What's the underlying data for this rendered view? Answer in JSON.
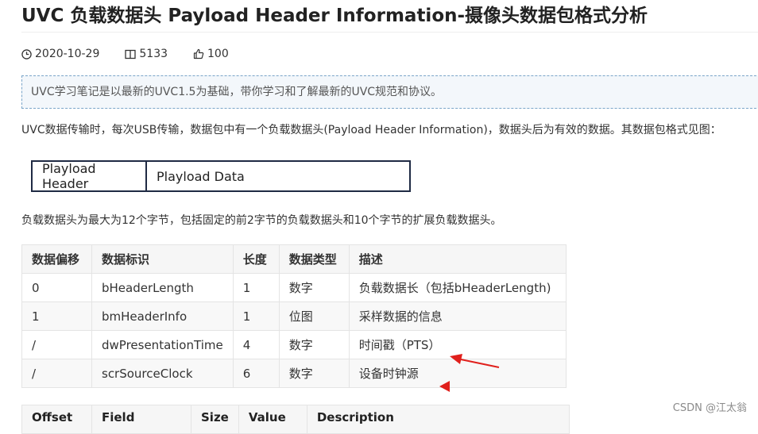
{
  "article": {
    "title": "UVC 负载数据头 Payload Header Information-摄像头数据包格式分析",
    "date": "2020-10-29",
    "views": "5133",
    "likes": "100",
    "note": "UVC学习笔记是以最新的UVC1.5为基础，带你学习和了解最新的UVC规范和协议。",
    "para1": "UVC数据传输时，每次USB传输，数据包中有一个负载数据头(Payload Header Information)，数据头后为有效的数据。其数据包格式见图：",
    "para2": "负载数据头为最大为12个字节，包括固定的前2字节的负载数据头和10个字节的扩展负载数据头。"
  },
  "payload_box": {
    "header": "Playload Header",
    "data": "Playload Data"
  },
  "table1": {
    "headers": [
      "数据偏移",
      "数据标识",
      "长度",
      "数据类型",
      "描述"
    ],
    "rows": [
      [
        "0",
        "bHeaderLength",
        "1",
        "数字",
        "负载数据长（包括bHeaderLength)"
      ],
      [
        "1",
        "bmHeaderInfo",
        "1",
        "位图",
        "采样数据的信息"
      ],
      [
        "/",
        "dwPresentationTime",
        "4",
        "数字",
        "时间戳（PTS）"
      ],
      [
        "/",
        "scrSourceClock",
        "6",
        "数字",
        "设备时钟源"
      ]
    ]
  },
  "table2": {
    "headers": [
      "Offset",
      "Field",
      "Size",
      "Value",
      "Description"
    ]
  },
  "watermark": "CSDN @江太翁",
  "colors": {
    "arrow": "#e0201c",
    "note_border": "#7aa5c9",
    "note_bg": "#f3f7fb",
    "box_border": "#1f2a44"
  }
}
